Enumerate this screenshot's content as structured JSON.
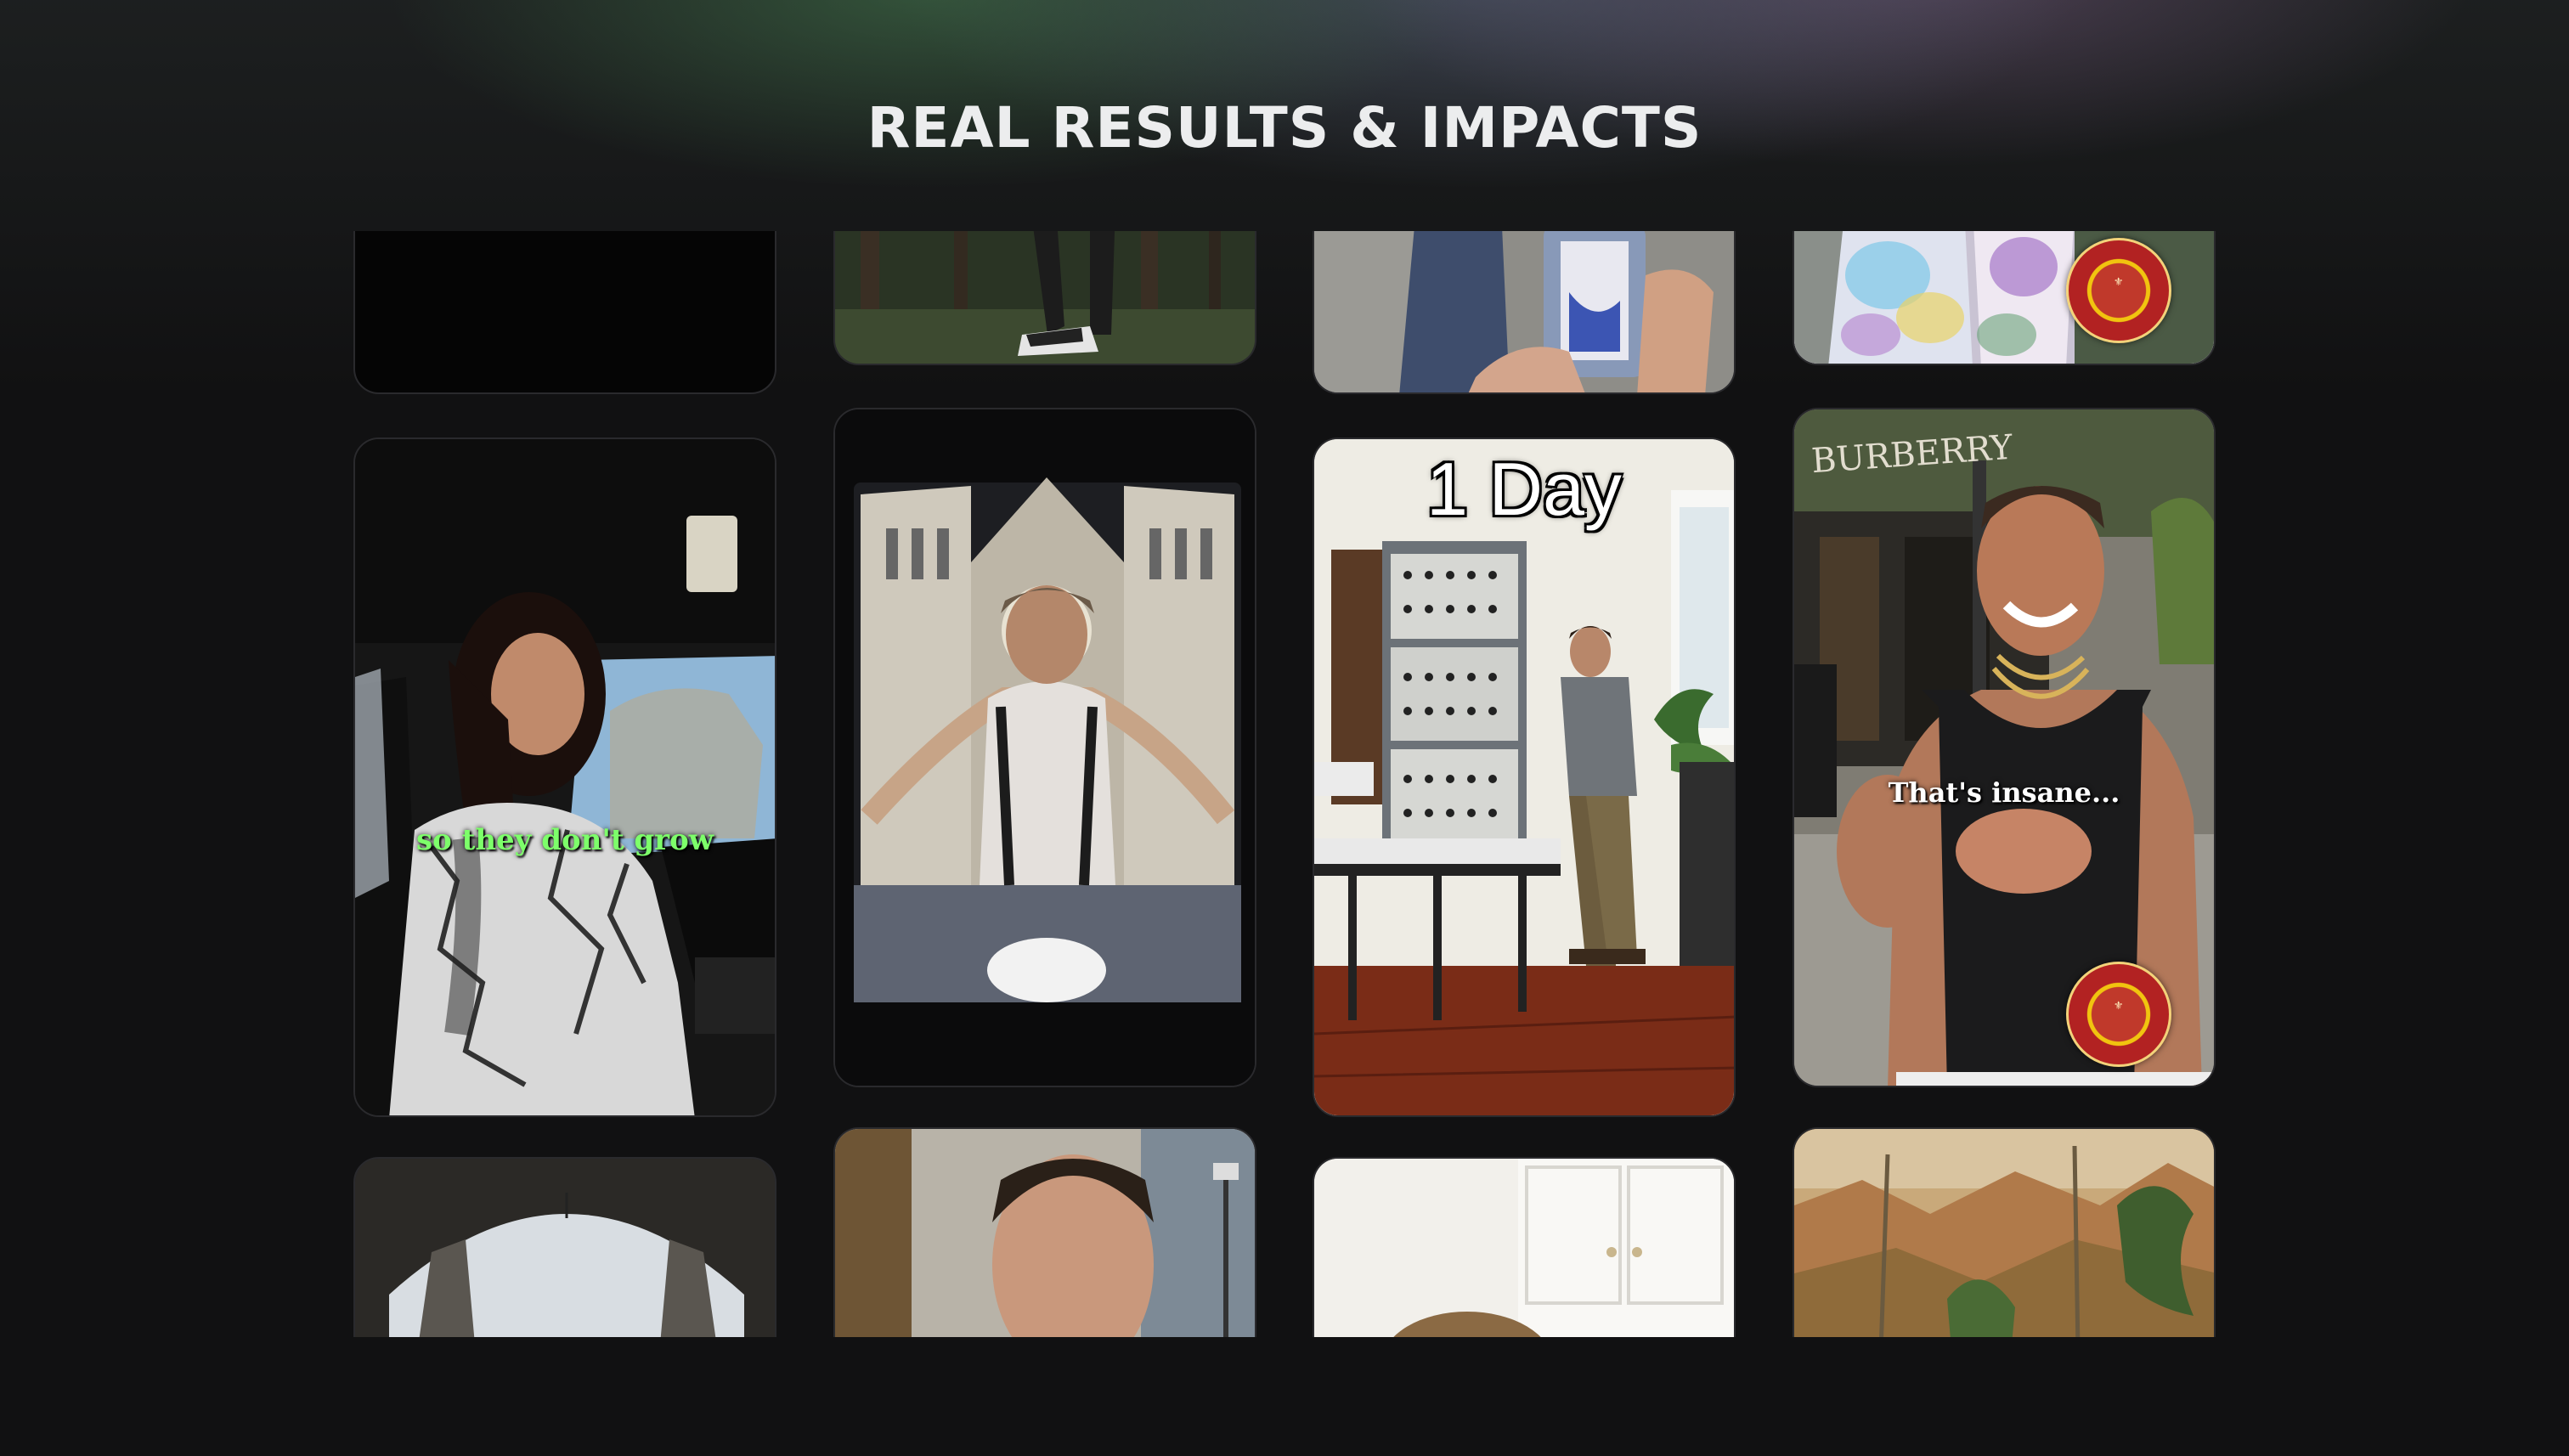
{
  "page": {
    "title": "REAL RESULTS & IMPACTS"
  },
  "grid": {
    "captions": {
      "car_subtitle": "so they don't grow",
      "studio_overlay": "1 Day",
      "man_subtitle": "That's insane...",
      "storefront_sign": "BURBERRY"
    }
  },
  "colors": {
    "background": "#111112",
    "title_text": "#ecedee",
    "car_caption": "#7dff6a",
    "card_border": "#2a2a2d"
  },
  "icons": {
    "logo_badge": "school-logo-badge"
  }
}
